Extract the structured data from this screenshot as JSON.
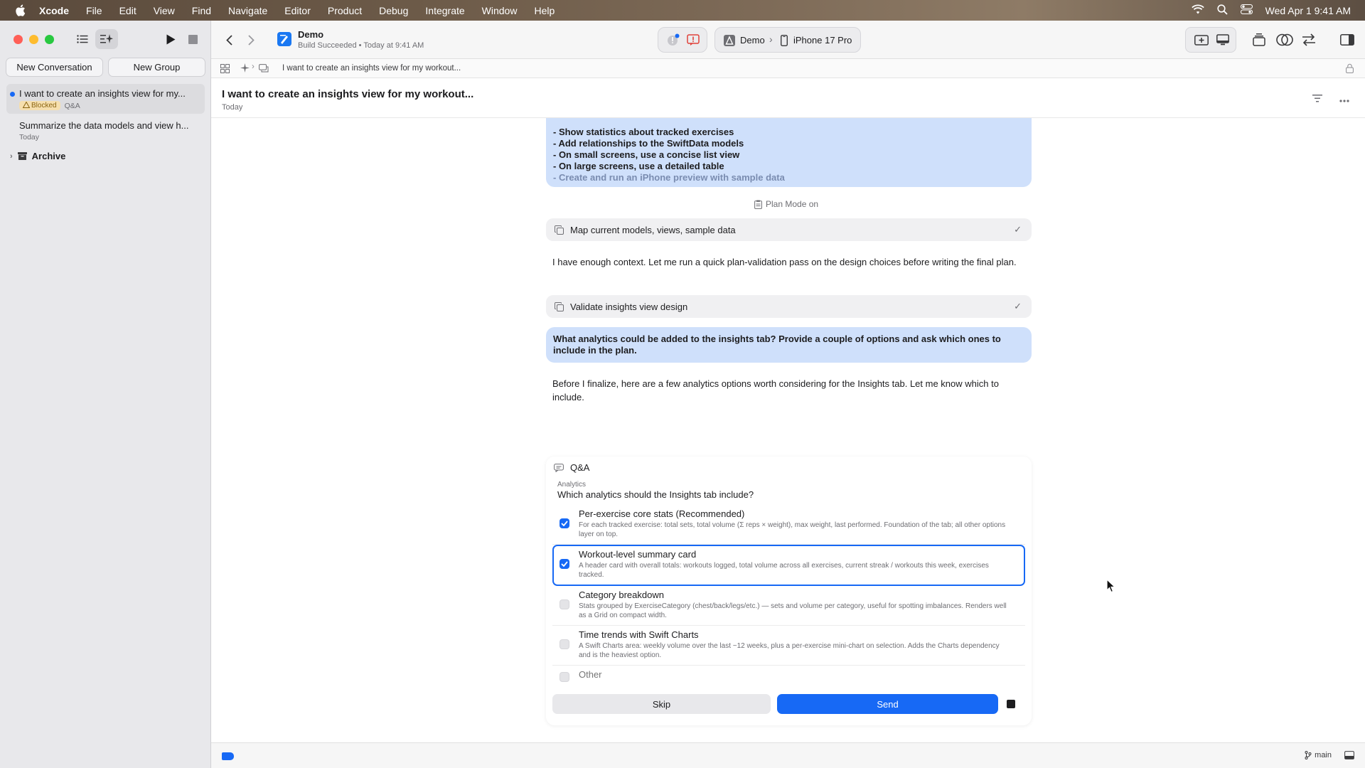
{
  "menubar": {
    "app_name": "Xcode",
    "items": [
      "File",
      "Edit",
      "View",
      "Find",
      "Navigate",
      "Editor",
      "Product",
      "Debug",
      "Integrate",
      "Window",
      "Help"
    ],
    "clock": "Wed Apr 1  9:41 AM"
  },
  "sidebar": {
    "new_conversation": "New Conversation",
    "new_group": "New Group",
    "conversations": [
      {
        "title": "I want to create an insights view for my...",
        "badge": "Blocked",
        "tag": "Q&A"
      },
      {
        "title": "Summarize the data models and view h...",
        "date": "Today"
      }
    ],
    "archive": "Archive"
  },
  "toolbar": {
    "project": "Demo",
    "build_status": "Build Succeeded • Today at 9:41 AM",
    "scheme": "Demo",
    "device": "iPhone 17 Pro"
  },
  "pathbar": {
    "crumb": "I want to create an insights view for my workout..."
  },
  "header": {
    "title": "I want to create an insights view for my workout...",
    "date": "Today"
  },
  "chat": {
    "plan_bullets": [
      "- Show statistics about tracked exercises",
      "- Add relationships to the SwiftData models",
      "- On small screens, use a concise list view",
      "- On large screens, use a detailed table",
      "- Create and run an iPhone preview with sample data"
    ],
    "plan_mode": "Plan Mode on",
    "tool1": "Map current models, views, sample data",
    "para1": "I have enough context. Let me run a quick plan-validation pass on the design choices before writing the final plan.",
    "tool2": "Validate insights view design",
    "user_msg": "What analytics could be added to the insights tab? Provide a couple of options and ask which ones to include in the plan.",
    "para2": "Before I finalize, here are a few analytics options worth considering for the Insights tab. Let me know which to include."
  },
  "qa": {
    "header": "Q&A",
    "section": "Analytics",
    "question": "Which analytics should the Insights tab include?",
    "options": [
      {
        "title": "Per-exercise core stats (Recommended)",
        "desc": "For each tracked exercise: total sets, total volume (Σ reps × weight), max weight, last performed. Foundation of the tab; all other options layer on top.",
        "checked": true
      },
      {
        "title": "Workout-level summary card",
        "desc": "A header card with overall totals: workouts logged, total volume across all exercises, current streak / workouts this week, exercises tracked.",
        "checked": true
      },
      {
        "title": "Category breakdown",
        "desc": "Stats grouped by ExerciseCategory (chest/back/legs/etc.) — sets and volume per category, useful for spotting imbalances. Renders well as a Grid on compact width.",
        "checked": false
      },
      {
        "title": "Time trends with Swift Charts",
        "desc": "A Swift Charts area: weekly volume over the last ~12 weeks, plus a per-exercise mini-chart on selection. Adds the Charts dependency and is the heaviest option.",
        "checked": false
      }
    ],
    "other_placeholder": "Other",
    "skip": "Skip",
    "send": "Send"
  },
  "footer": {
    "branch": "main"
  },
  "colors": {
    "accent": "#1769f5",
    "user_bubble": "#cfe0fb",
    "sidebar_bg": "#e8e8eb"
  }
}
